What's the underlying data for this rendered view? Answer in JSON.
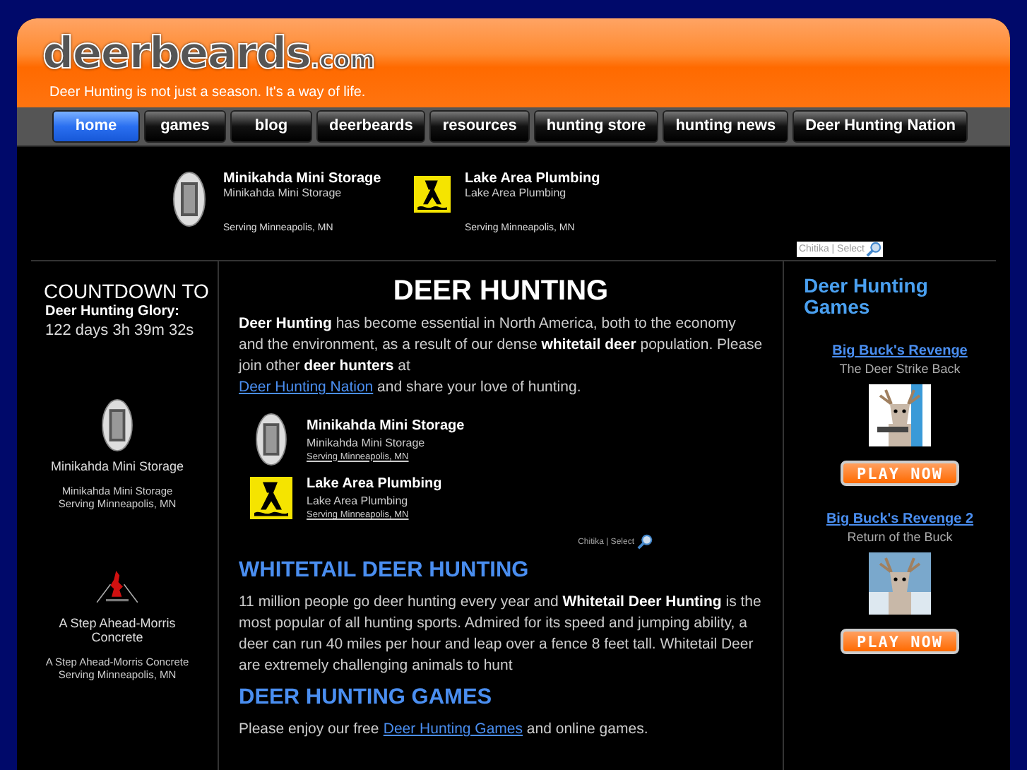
{
  "logo": {
    "name": "deerbeards",
    "suffix": ".com",
    "tagline": "Deer Hunting is not just a season. It's a way of life."
  },
  "nav": [
    {
      "label": "home",
      "selected": true
    },
    {
      "label": "games",
      "selected": false
    },
    {
      "label": "blog",
      "selected": false
    },
    {
      "label": "deerbeards",
      "selected": false
    },
    {
      "label": "resources",
      "selected": false
    },
    {
      "label": "hunting store",
      "selected": false
    },
    {
      "label": "hunting news",
      "selected": false
    },
    {
      "label": "Deer Hunting Nation",
      "selected": false
    }
  ],
  "top_ads": {
    "items": [
      {
        "kind": "storage",
        "title": "Minikahda Mini Storage",
        "subtitle": "Minikahda Mini Storage",
        "location": "Serving Minneapolis, MN"
      },
      {
        "kind": "plumbing",
        "title": "Lake Area Plumbing",
        "subtitle": "Lake Area Plumbing",
        "location": "Serving Minneapolis, MN"
      }
    ],
    "credit": "Chitika | Select"
  },
  "left": {
    "countdown": {
      "heading": "COUNTDOWN TO",
      "subheading": "Deer Hunting Glory:",
      "time": "122 days 3h 39m 32s"
    },
    "ads": [
      {
        "kind": "storage",
        "title": "Minikahda Mini Storage",
        "subtitle": "Minikahda Mini Storage",
        "location": "Serving Minneapolis, MN"
      },
      {
        "kind": "concrete",
        "title": "A Step Ahead-Morris Concrete",
        "subtitle": "A Step Ahead-Morris Concrete",
        "location": "Serving Minneapolis, MN"
      }
    ]
  },
  "main": {
    "heading": "DEER HUNTING",
    "intro": {
      "text": "**Deer Hunting** has become essential in North America, both to the economy and the environment, as a result of our dense **whitetail deer** population. Please join other **deer hunters** at",
      "link": "Deer Hunting Nation",
      "after": "and share your love of hunting."
    },
    "ads": {
      "items": [
        {
          "kind": "storage",
          "title": "Minikahda Mini Storage",
          "subtitle": "Minikahda Mini Storage",
          "location": "Serving Minneapolis, MN"
        },
        {
          "kind": "plumbing",
          "title": "Lake Area Plumbing",
          "subtitle": "Lake Area Plumbing",
          "location": "Serving Minneapolis, MN"
        }
      ],
      "credit": "Chitika | Select"
    },
    "sections": [
      {
        "heading": "WHITETAIL DEER HUNTING",
        "text": "11 million people go deer hunting every year and **Whitetail Deer Hunting** is the most popular of all hunting sports. Admired for its speed and jumping ability, a deer can run 40 miles per hour and leap over a fence 8 feet tall. Whitetail Deer are extremely challenging animals to hunt"
      },
      {
        "heading": "DEER HUNTING GAMES",
        "text": "Please enjoy our free",
        "link": "Deer Hunting Games",
        "after": "and online games."
      }
    ]
  },
  "right": {
    "heading": "Deer Hunting Games",
    "games": [
      {
        "kind": "orange",
        "title": "Big Buck's Revenge",
        "subtitle": "The Deer Strike Back",
        "button": "PLAY NOW"
      },
      {
        "kind": "blue",
        "title": "Big Buck's Revenge 2",
        "subtitle": "Return of the Buck",
        "button": "PLAY NOW"
      }
    ]
  }
}
